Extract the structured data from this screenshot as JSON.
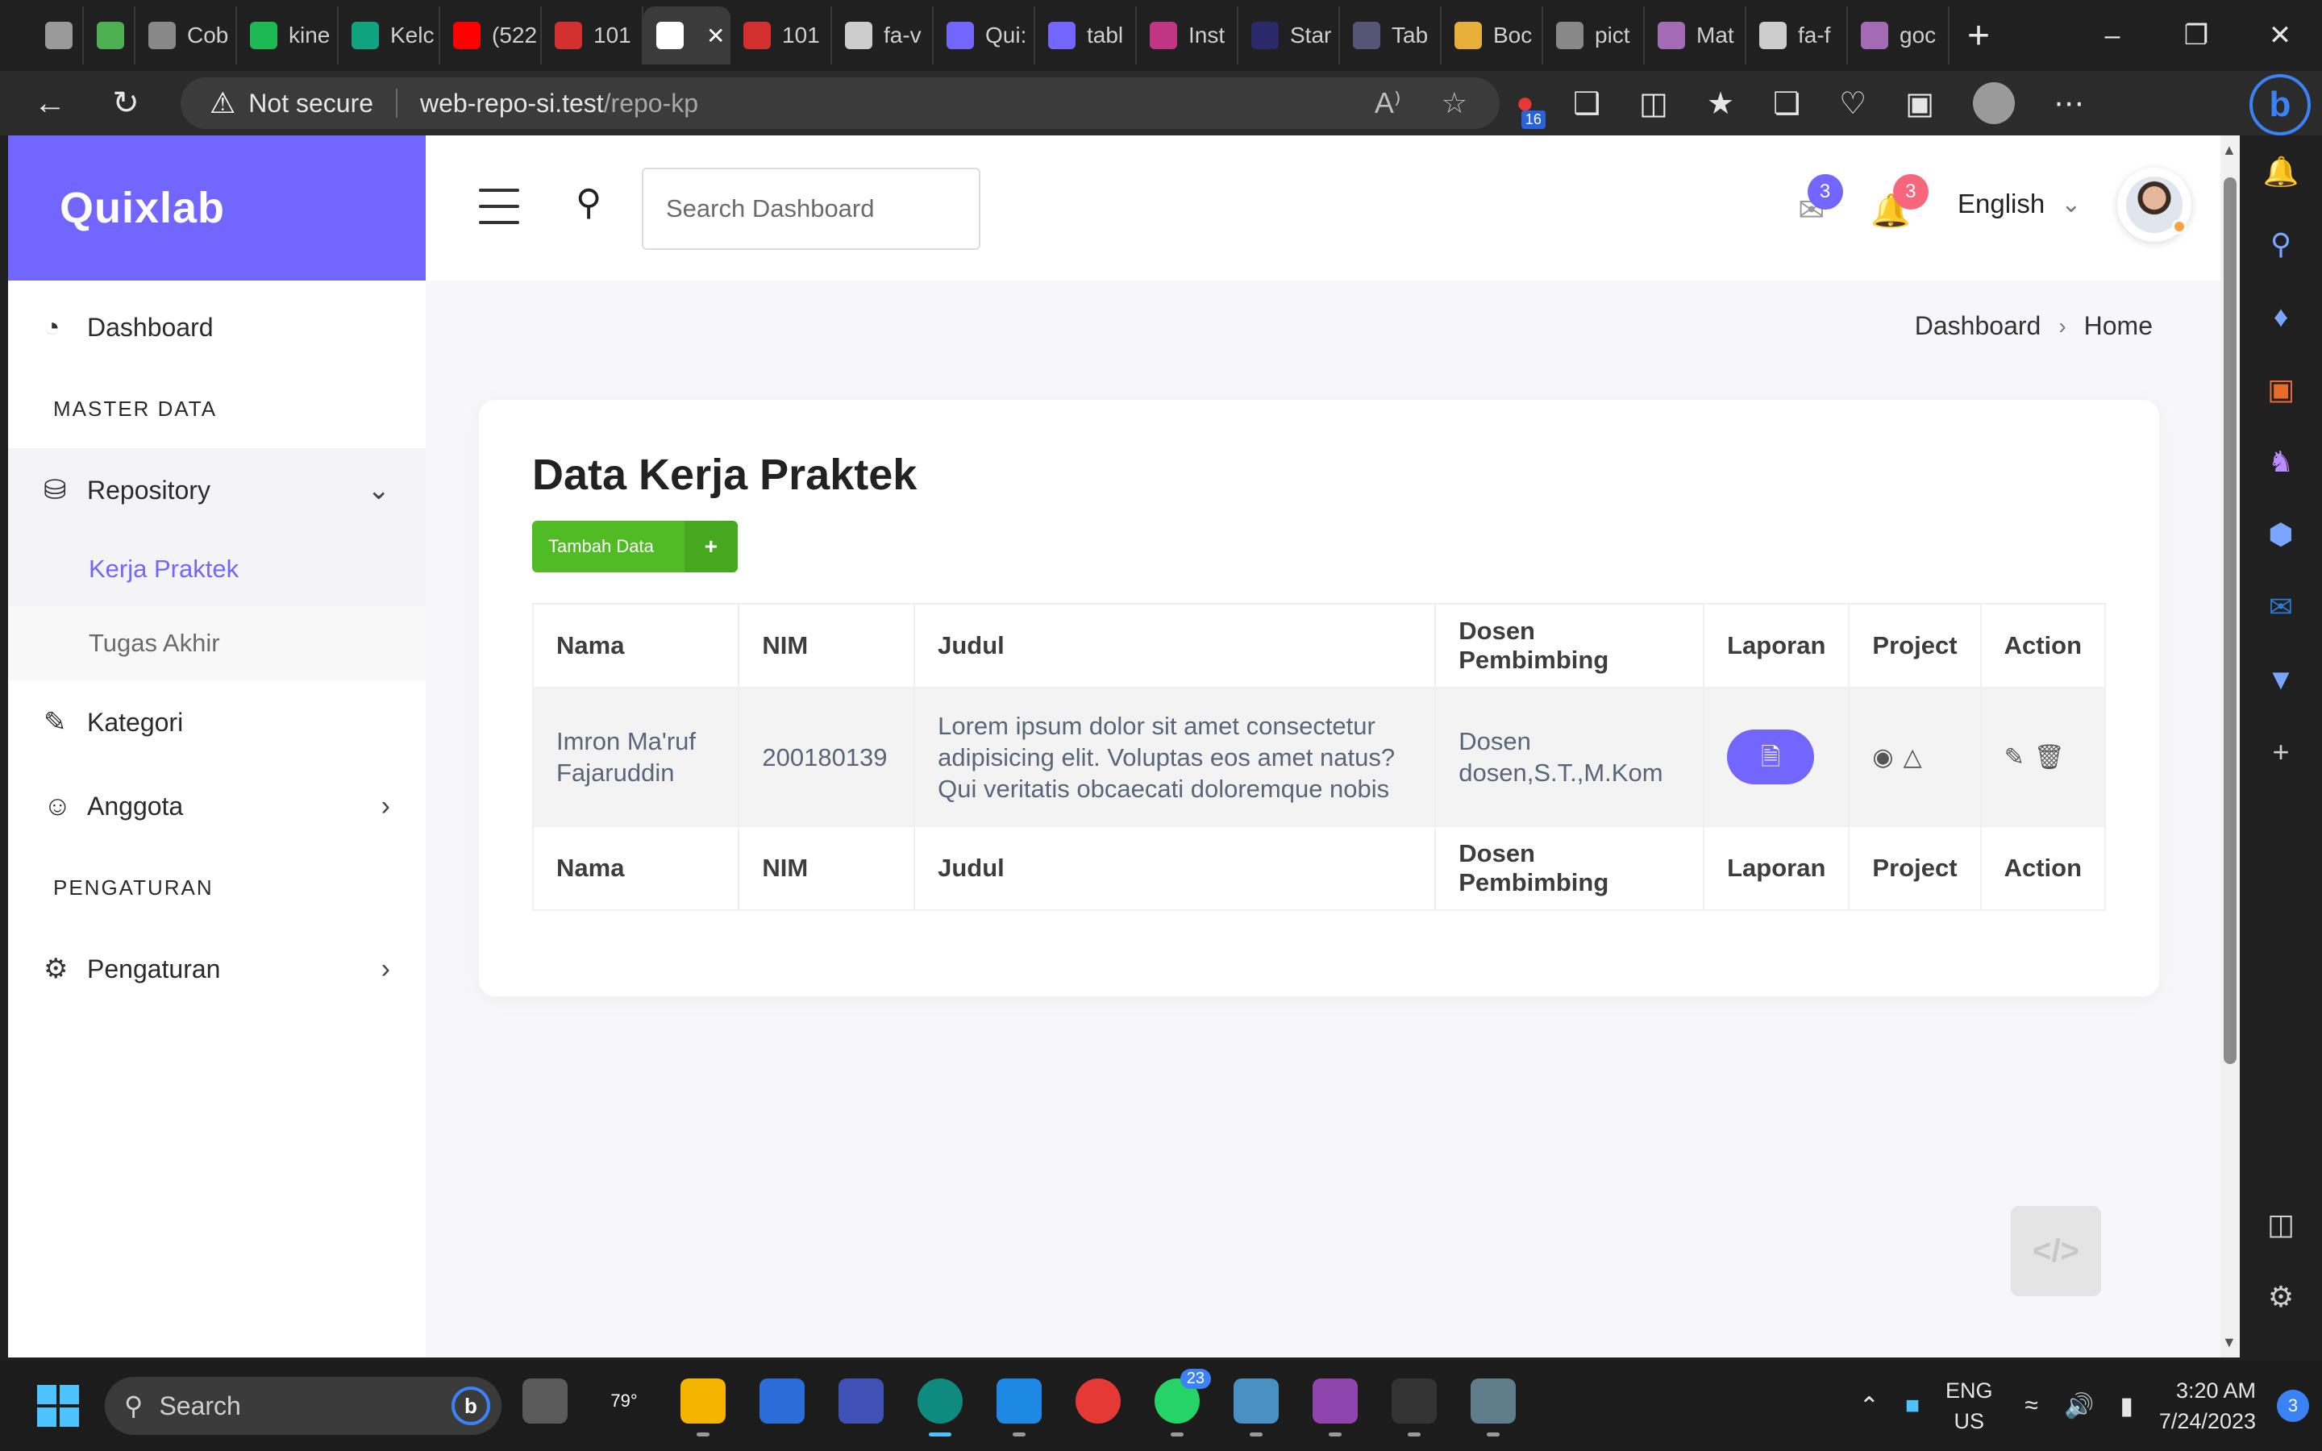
{
  "browser": {
    "tabs": [
      {
        "label": "",
        "color": "#9a9a9a"
      },
      {
        "label": "",
        "color": "#4caf50"
      },
      {
        "label": "Cob",
        "color": "#888888"
      },
      {
        "label": "kine",
        "color": "#1db954"
      },
      {
        "label": "Kelc",
        "color": "#10a37f"
      },
      {
        "label": "(522",
        "color": "#ff0000"
      },
      {
        "label": "101",
        "color": "#d32f2f"
      },
      {
        "label": "",
        "color": "#ffffff"
      },
      {
        "label": "101",
        "color": "#d32f2f"
      },
      {
        "label": "fa-v",
        "color": "#cccccc"
      },
      {
        "label": "Qui:",
        "color": "#7366ff"
      },
      {
        "label": "tabl",
        "color": "#7366ff"
      },
      {
        "label": "Inst",
        "color": "#c13584"
      },
      {
        "label": "Star",
        "color": "#2a2a6a"
      },
      {
        "label": "Tab",
        "color": "#555577"
      },
      {
        "label": "Boc",
        "color": "#e8b03a"
      },
      {
        "label": "pict",
        "color": "#888888"
      },
      {
        "label": "Mat",
        "color": "#a36bb3"
      },
      {
        "label": "fa-f",
        "color": "#cccccc"
      },
      {
        "label": "goc",
        "color": "#a36bb3"
      }
    ],
    "active_tab_index": 7,
    "security_label": "Not secure",
    "url_host": "web-repo-si.test",
    "url_path": "/repo-kp",
    "extension_badge": "16"
  },
  "app": {
    "brand": "Quixlab",
    "sidebar": {
      "dashboard": "Dashboard",
      "section_master": "MASTER DATA",
      "repository": "Repository",
      "kerja_praktek": "Kerja Praktek",
      "tugas_akhir": "Tugas Akhir",
      "kategori": "Kategori",
      "anggota": "Anggota",
      "section_pengaturan": "PENGATURAN",
      "pengaturan": "Pengaturan"
    },
    "header": {
      "search_placeholder": "Search Dashboard",
      "mail_count": "3",
      "notif_count": "3",
      "language": "English",
      "mail_badge_color": "#7366ff",
      "notif_badge_color": "#f73164"
    },
    "breadcrumb": [
      "Dashboard",
      "Home"
    ],
    "card": {
      "title": "Data Kerja Praktek",
      "add_button": "Tambah Data",
      "add_button_icon": "+",
      "columns": [
        "Nama",
        "NIM",
        "Judul",
        "Dosen Pembimbing",
        "Laporan",
        "Project",
        "Action"
      ],
      "rows": [
        {
          "nama": "Imron Ma'ruf Fajaruddin",
          "nim": "200180139",
          "judul": "Lorem ipsum dolor sit amet consectetur adipisicing elit. Voluptas eos amet natus? Qui veritatis obcaecati doloremque nobis",
          "dosen": "Dosen dosen,S.T.,M.Kom"
        }
      ]
    },
    "accent_color": "#7366ff",
    "success_color": "#51bb25"
  },
  "taskbar": {
    "search_label": "Search",
    "weather": "79°",
    "whatsapp_badge": "23",
    "lang_line1": "ENG",
    "lang_line2": "US",
    "time": "3:20 AM",
    "date": "7/24/2023",
    "notifications": "3"
  }
}
